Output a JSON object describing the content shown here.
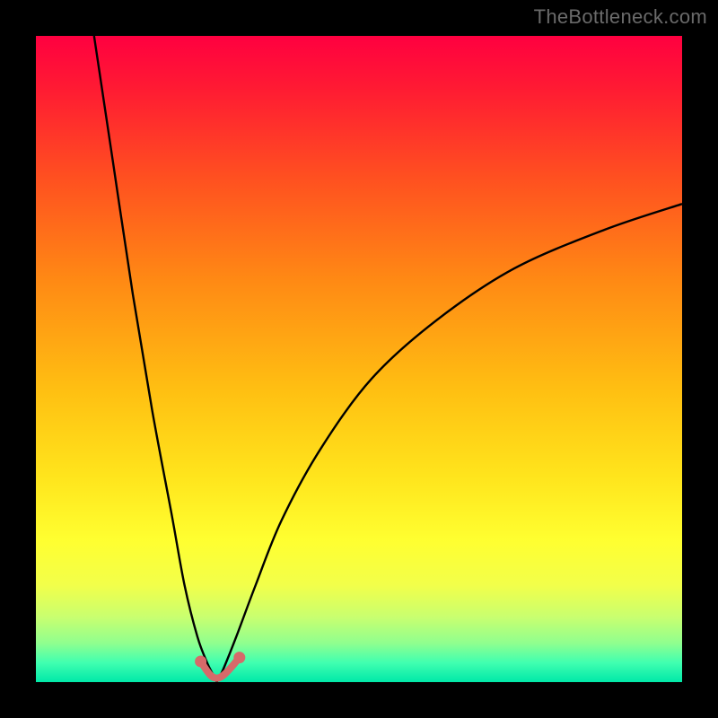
{
  "watermark": "TheBottleneck.com",
  "chart_data": {
    "type": "line",
    "title": "",
    "xlabel": "",
    "ylabel": "",
    "xlim": [
      0,
      100
    ],
    "ylim": [
      0,
      100
    ],
    "notch_x": 28,
    "series": [
      {
        "name": "curve-left",
        "x": [
          9,
          12,
          15,
          18,
          21,
          23,
          25,
          26.5,
          27.5,
          28
        ],
        "y": [
          100,
          80,
          60,
          42,
          26,
          15,
          7,
          3,
          1,
          0
        ]
      },
      {
        "name": "curve-right",
        "x": [
          28,
          29,
          31,
          34,
          38,
          44,
          52,
          62,
          74,
          88,
          100
        ],
        "y": [
          0,
          2,
          7,
          15,
          25,
          36,
          47,
          56,
          64,
          70,
          74
        ]
      },
      {
        "name": "notch-dots",
        "x": [
          25.5,
          26.5,
          27.2,
          28,
          28.8,
          29.6,
          30.5,
          31.5
        ],
        "y": [
          3.2,
          1.7,
          0.9,
          0.6,
          0.9,
          1.6,
          2.6,
          3.8
        ]
      }
    ],
    "colors": {
      "curve": "#000000",
      "dots": "#d66a6a"
    }
  }
}
